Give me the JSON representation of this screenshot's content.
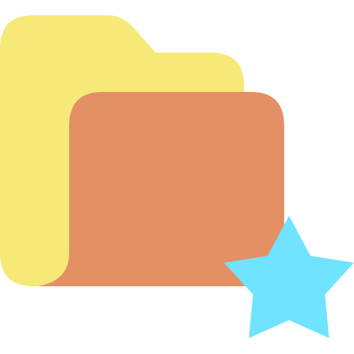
{
  "icon": {
    "name": "favorite-folder-icon",
    "parts": {
      "folder_back": "folder-back-icon",
      "folder_front": "folder-front-icon",
      "star": "star-icon"
    },
    "colors": {
      "folder_back": "#F7E978",
      "folder_front": "#E48F64",
      "star": "#6FE3FF",
      "background": "#FFFFFF"
    }
  }
}
